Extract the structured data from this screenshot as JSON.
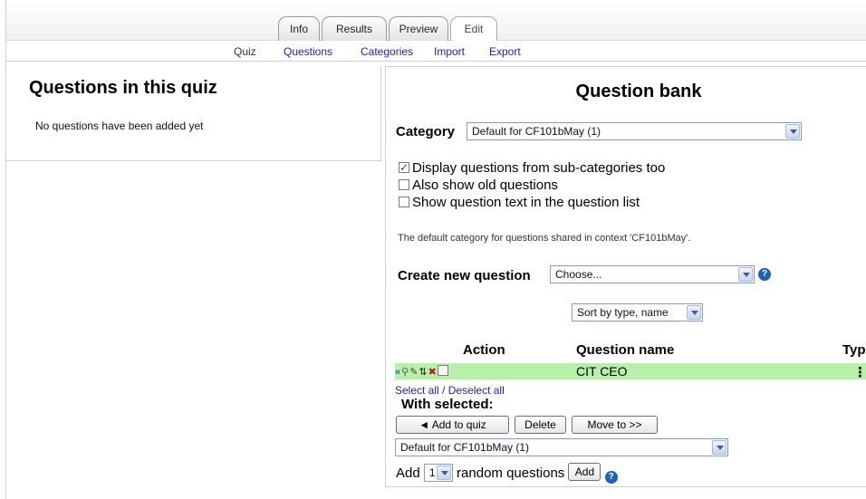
{
  "tabs": [
    "Info",
    "Results",
    "Preview",
    "Edit"
  ],
  "subtabs": [
    "Quiz",
    "Questions",
    "Categories",
    "Import",
    "Export"
  ],
  "left_panel": {
    "title": "Questions in this quiz",
    "empty_text": "No questions have been added yet"
  },
  "bank": {
    "title": "Question bank",
    "category_label": "Category",
    "category_value": "Default for CF101bMay (1)",
    "options": [
      {
        "label": "Display questions from sub-categories too",
        "checked": true
      },
      {
        "label": "Also show old questions",
        "checked": false
      },
      {
        "label": "Show question text in the question list",
        "checked": false
      }
    ],
    "info_text": "The default category for questions shared in context 'CF101bMay'.",
    "create_label": "Create new question",
    "create_value": "Choose...",
    "sort_value": "Sort by type, name",
    "col_action": "Action",
    "col_name": "Question name",
    "col_type": "Typ",
    "question": {
      "name": "CIT CEO",
      "type_icon": "⋮"
    },
    "select_all": "Select all",
    "link_sep": "/",
    "deselect_all": "Deselect all",
    "with_selected": "With selected:",
    "btn_add_quiz": "◄ Add to quiz",
    "btn_delete": "Delete",
    "btn_move": "Move to >>",
    "move_category": "Default for CF101bMay (1)",
    "add_text": "Add",
    "random_count": "1",
    "random_text": "random questions",
    "btn_add": "Add",
    "help_glyph": "?"
  }
}
